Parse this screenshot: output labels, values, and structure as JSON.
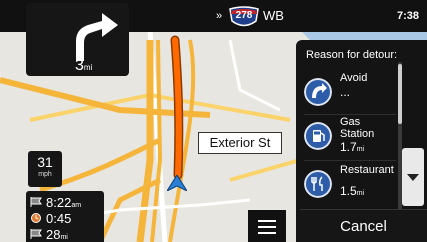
{
  "header": {
    "route_number": "278",
    "direction": "WB",
    "chevron": "»",
    "time": "7:38"
  },
  "turn": {
    "distance": "3",
    "unit": "mi",
    "icon": "turn-arrow-icon"
  },
  "speed": {
    "value": "31",
    "unit": "mph"
  },
  "trip": {
    "rows": [
      {
        "icon": "flag-icon",
        "value": "8:22",
        "unit": "am"
      },
      {
        "icon": "clock-icon",
        "value": "0:45",
        "unit": ""
      },
      {
        "icon": "flag-icon",
        "value": "28",
        "unit": "mi"
      }
    ]
  },
  "map": {
    "street_label": "Exterior St"
  },
  "detour": {
    "title": "Reason for detour:",
    "options": [
      {
        "label": "Avoid",
        "sub": "...",
        "unit": "",
        "icon": "avoid-icon"
      },
      {
        "label": "Gas Station",
        "sub": "1.7",
        "unit": "mi",
        "icon": "gas-pump-icon"
      },
      {
        "label": "Restaurant",
        "sub": "1.5",
        "unit": "mi",
        "icon": "restaurant-icon"
      }
    ],
    "cancel_label": "Cancel"
  },
  "colors": {
    "route": "#ff6a00",
    "highway": "#f6b736",
    "option_circle": "#2d5da8"
  }
}
